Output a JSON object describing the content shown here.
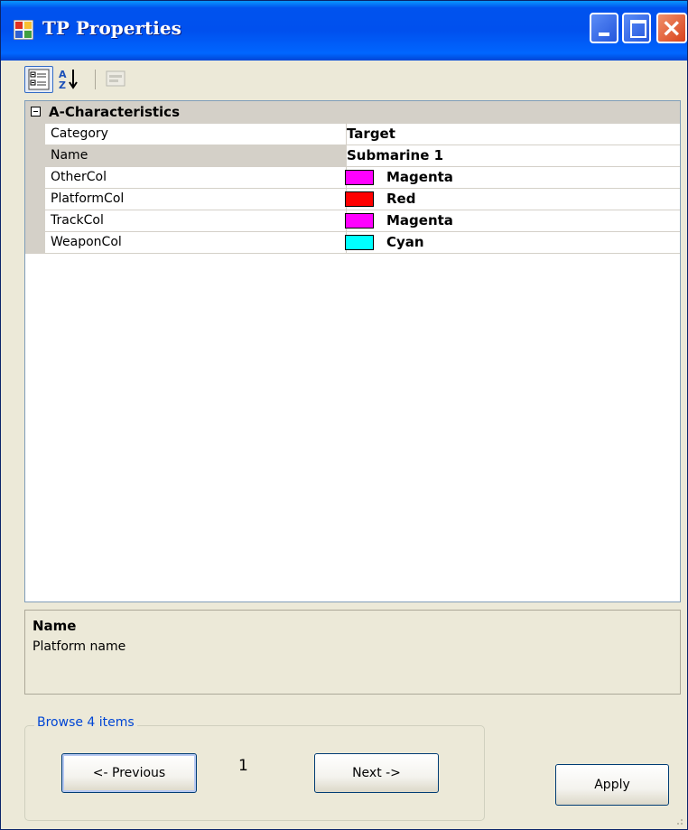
{
  "window": {
    "title": "TP  Properties"
  },
  "toolbar": {
    "categorized_icon": "categorized-icon",
    "alphabetical_icon": "alphabetical-icon",
    "property_pages_icon": "property-pages-icon"
  },
  "grid": {
    "category": "A-Characteristics",
    "properties": [
      {
        "name": "Category",
        "value": "Target",
        "color": null
      },
      {
        "name": "Name",
        "value": "Submarine 1",
        "color": null,
        "selected": true
      },
      {
        "name": "OtherCol",
        "value": "Magenta",
        "color": "#ff00ff"
      },
      {
        "name": "PlatformCol",
        "value": "Red",
        "color": "#ff0000"
      },
      {
        "name": "TrackCol",
        "value": "Magenta",
        "color": "#ff00ff"
      },
      {
        "name": "WeaponCol",
        "value": "Cyan",
        "color": "#00ffff"
      }
    ]
  },
  "help": {
    "title": "Name",
    "description": "Platform name"
  },
  "browse": {
    "legend": "Browse 4 items",
    "previous_label": "<- Previous",
    "page_number": "1",
    "next_label": "Next ->"
  },
  "apply_label": "Apply",
  "colors": {
    "titlebar": "#0053ee",
    "accent": "#0046d5",
    "face": "#ece9d8"
  }
}
